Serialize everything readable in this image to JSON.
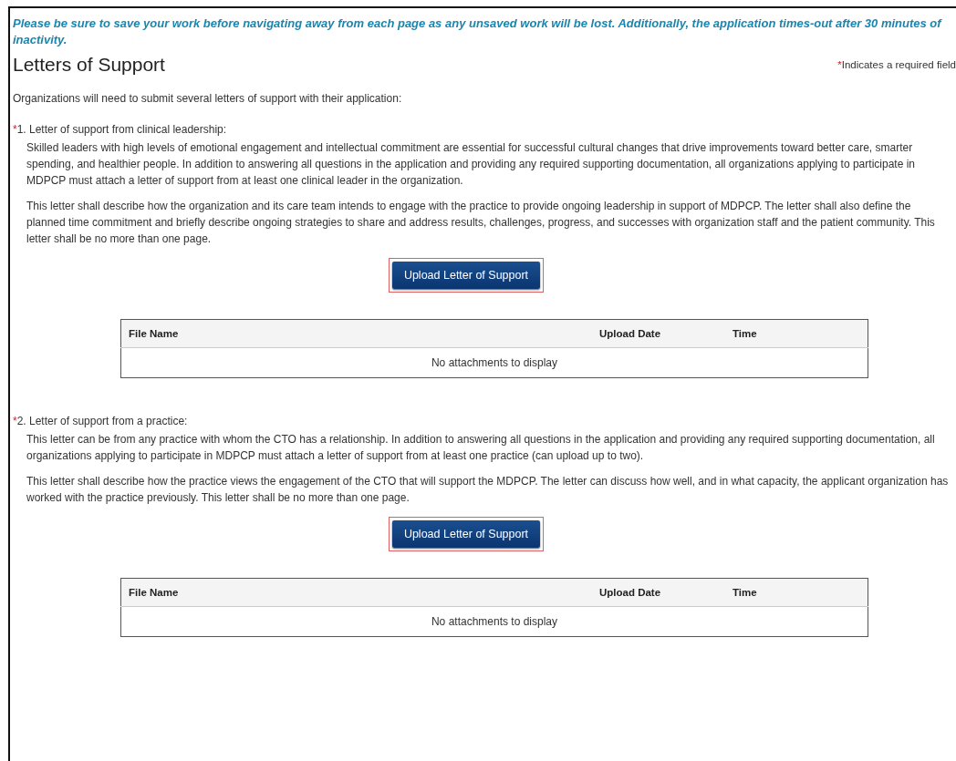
{
  "notice": "Please be sure to save your work before navigating away from each page as any unsaved work will be lost. Additionally, the application times-out after 30 minutes of inactivity.",
  "title": "Letters of Support",
  "required_note": {
    "marker": "*",
    "text": "Indicates a required field"
  },
  "intro": "Organizations will need to submit several letters of support with their application:",
  "sections": [
    {
      "marker": "*",
      "label": "1. Letter of support from clinical leadership:",
      "paragraphs": [
        "Skilled leaders with high levels of emotional engagement and intellectual commitment are essential for successful cultural changes that drive improvements toward better care, smarter spending, and healthier people. In addition to answering all questions in the application and providing any required supporting documentation, all organizations applying to participate in MDPCP must attach a letter of support from at least one clinical leader in the organization.",
        "This letter shall describe how the organization and its care team intends to engage with the practice to provide ongoing leadership in support of MDPCP. The letter shall also define the planned time commitment and briefly describe ongoing strategies to share and address results, challenges, progress, and successes with organization staff and the patient community. This letter shall be no more than one page."
      ],
      "button": {
        "label": "Upload Letter of Support",
        "highlighted": true
      },
      "table": {
        "columns": [
          "File Name",
          "Upload Date",
          "Time"
        ],
        "empty": "No attachments to display"
      }
    },
    {
      "marker": "*",
      "label": "2. Letter of support from a practice:",
      "paragraphs": [
        "This letter can be from any practice with whom the CTO has a relationship. In addition to answering all questions in the application and providing any required supporting documentation, all organizations applying to participate in MDPCP must attach a letter of support from at least one practice (can upload up to two).",
        "This letter shall describe how the practice views the engagement of the CTO that will support the MDPCP. The letter can discuss how well, and in what capacity, the applicant organization has worked with the practice previously. This letter shall be no more than one page."
      ],
      "button": {
        "label": "Upload Letter of Support",
        "highlighted": true
      },
      "table": {
        "columns": [
          "File Name",
          "Upload Date",
          "Time"
        ],
        "empty": "No attachments to display"
      }
    }
  ]
}
